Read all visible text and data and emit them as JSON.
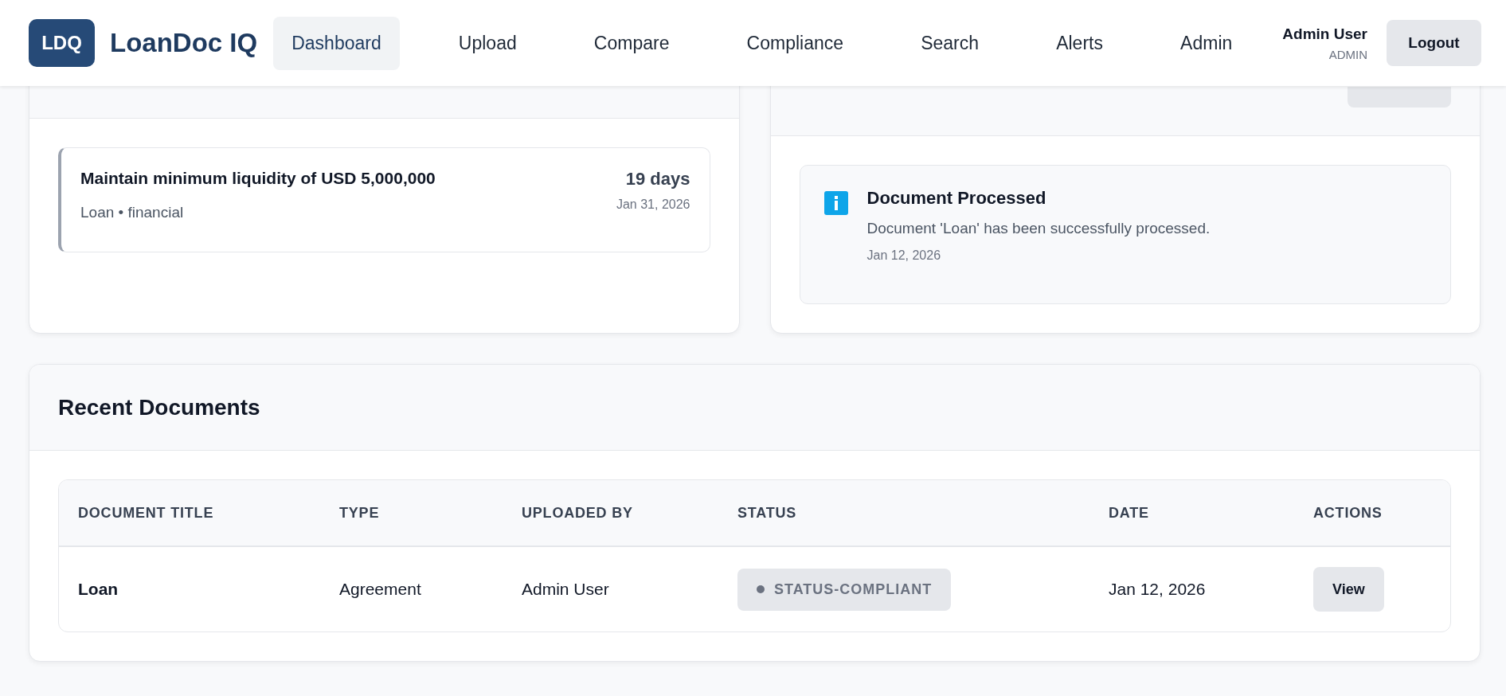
{
  "header": {
    "logo": "LDQ",
    "brand": "LoanDoc IQ",
    "nav": [
      {
        "label": "Dashboard",
        "selected": true
      },
      {
        "label": "Upload",
        "selected": false
      },
      {
        "label": "Compare",
        "selected": false
      },
      {
        "label": "Compliance",
        "selected": false
      },
      {
        "label": "Search",
        "selected": false
      },
      {
        "label": "Alerts",
        "selected": false
      },
      {
        "label": "Admin",
        "selected": false
      }
    ],
    "user": {
      "name": "Admin User",
      "role": "ADMIN"
    },
    "logout": "Logout"
  },
  "obligations_panel": {
    "items": [
      {
        "title": "Maintain minimum liquidity of USD 5,000,000",
        "meta": "Loan • financial",
        "due_in": "19 days",
        "due_date": "Jan 31, 2026"
      }
    ]
  },
  "alerts_panel": {
    "alerts": [
      {
        "kind": "info",
        "title": "Document Processed",
        "message": "Document 'Loan' has been successfully processed.",
        "date": "Jan 12, 2026"
      }
    ]
  },
  "documents_panel": {
    "title": "Recent Documents",
    "table": {
      "columns": [
        "DOCUMENT TITLE",
        "TYPE",
        "UPLOADED BY",
        "STATUS",
        "DATE",
        "ACTIONS"
      ],
      "rows": [
        {
          "title": "Loan",
          "type": "Agreement",
          "uploaded_by": "Admin User",
          "status": "STATUS-COMPLIANT",
          "date": "Jan 12, 2026",
          "action": "View"
        }
      ]
    }
  }
}
